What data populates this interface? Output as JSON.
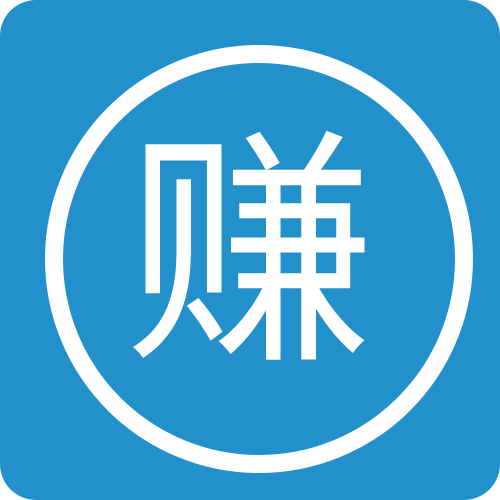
{
  "icon": {
    "glyph": "赚",
    "background_color": "#2291cb",
    "ring_color": "#ffffff",
    "glyph_color": "#ffffff"
  }
}
